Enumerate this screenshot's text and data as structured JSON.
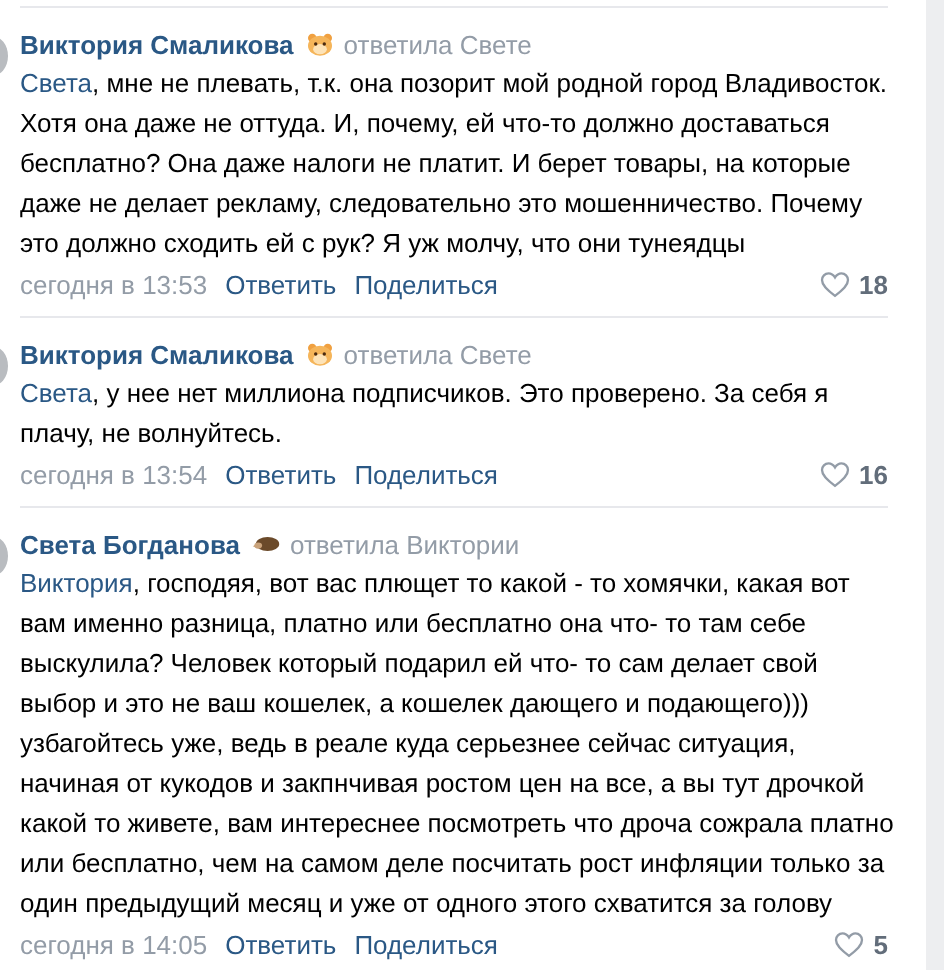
{
  "comments": [
    {
      "author": "Виктория Смаликова",
      "kind": "hamster",
      "reply_to": "ответила Свете",
      "mention": "Света",
      "text": ", мне не плевать, т.к. она позорит мой родной город Владивосток. Хотя она даже не оттуда. И, почему, ей что-то должно доставаться бесплатно? Она даже налоги не платит. И берет товары, на которые даже не делает рекламу, следовательно это мошенничество. Почему это должно сходить ей с рук? Я уж молчу, что они тунеядцы",
      "time": "сегодня в 13:53",
      "reply_label": "Ответить",
      "share_label": "Поделиться",
      "likes": "18"
    },
    {
      "author": "Виктория Смаликова",
      "kind": "hamster",
      "reply_to": "ответила Свете",
      "mention": "Света",
      "text": ", у нее нет миллиона подписчиков. Это проверено. За себя я плачу, не волнуйтесь.",
      "time": "сегодня в 13:54",
      "reply_label": "Ответить",
      "share_label": "Поделиться",
      "likes": "16"
    },
    {
      "author": "Света Богданова",
      "kind": "hedgehog",
      "reply_to": "ответила Виктории",
      "mention": "Виктория",
      "text": ", господяя, вот вас плющет то какой - то хомячки, какая вот вам именно разница, платно или бесплатно она что- то там себе выскулила? Человек который подарил ей что- то сам делает свой выбор и это не ваш кошелек, а кошелек дающего и подающего))) узбагойтесь уже, ведь в реале куда серьезнее сейчас ситуация, начиная от кукодов и закпнчивая ростом цен на все, а вы тут дрочкой какой то живете, вам интереснее посмотреть что дроча сожрала платно или бесплатно, чем на самом деле посчитать рост инфляции только за один предыдущий месяц и уже от одного этого схватится за голову",
      "time": "сегодня в 14:05",
      "reply_label": "Ответить",
      "share_label": "Поделиться",
      "likes": "5"
    }
  ]
}
